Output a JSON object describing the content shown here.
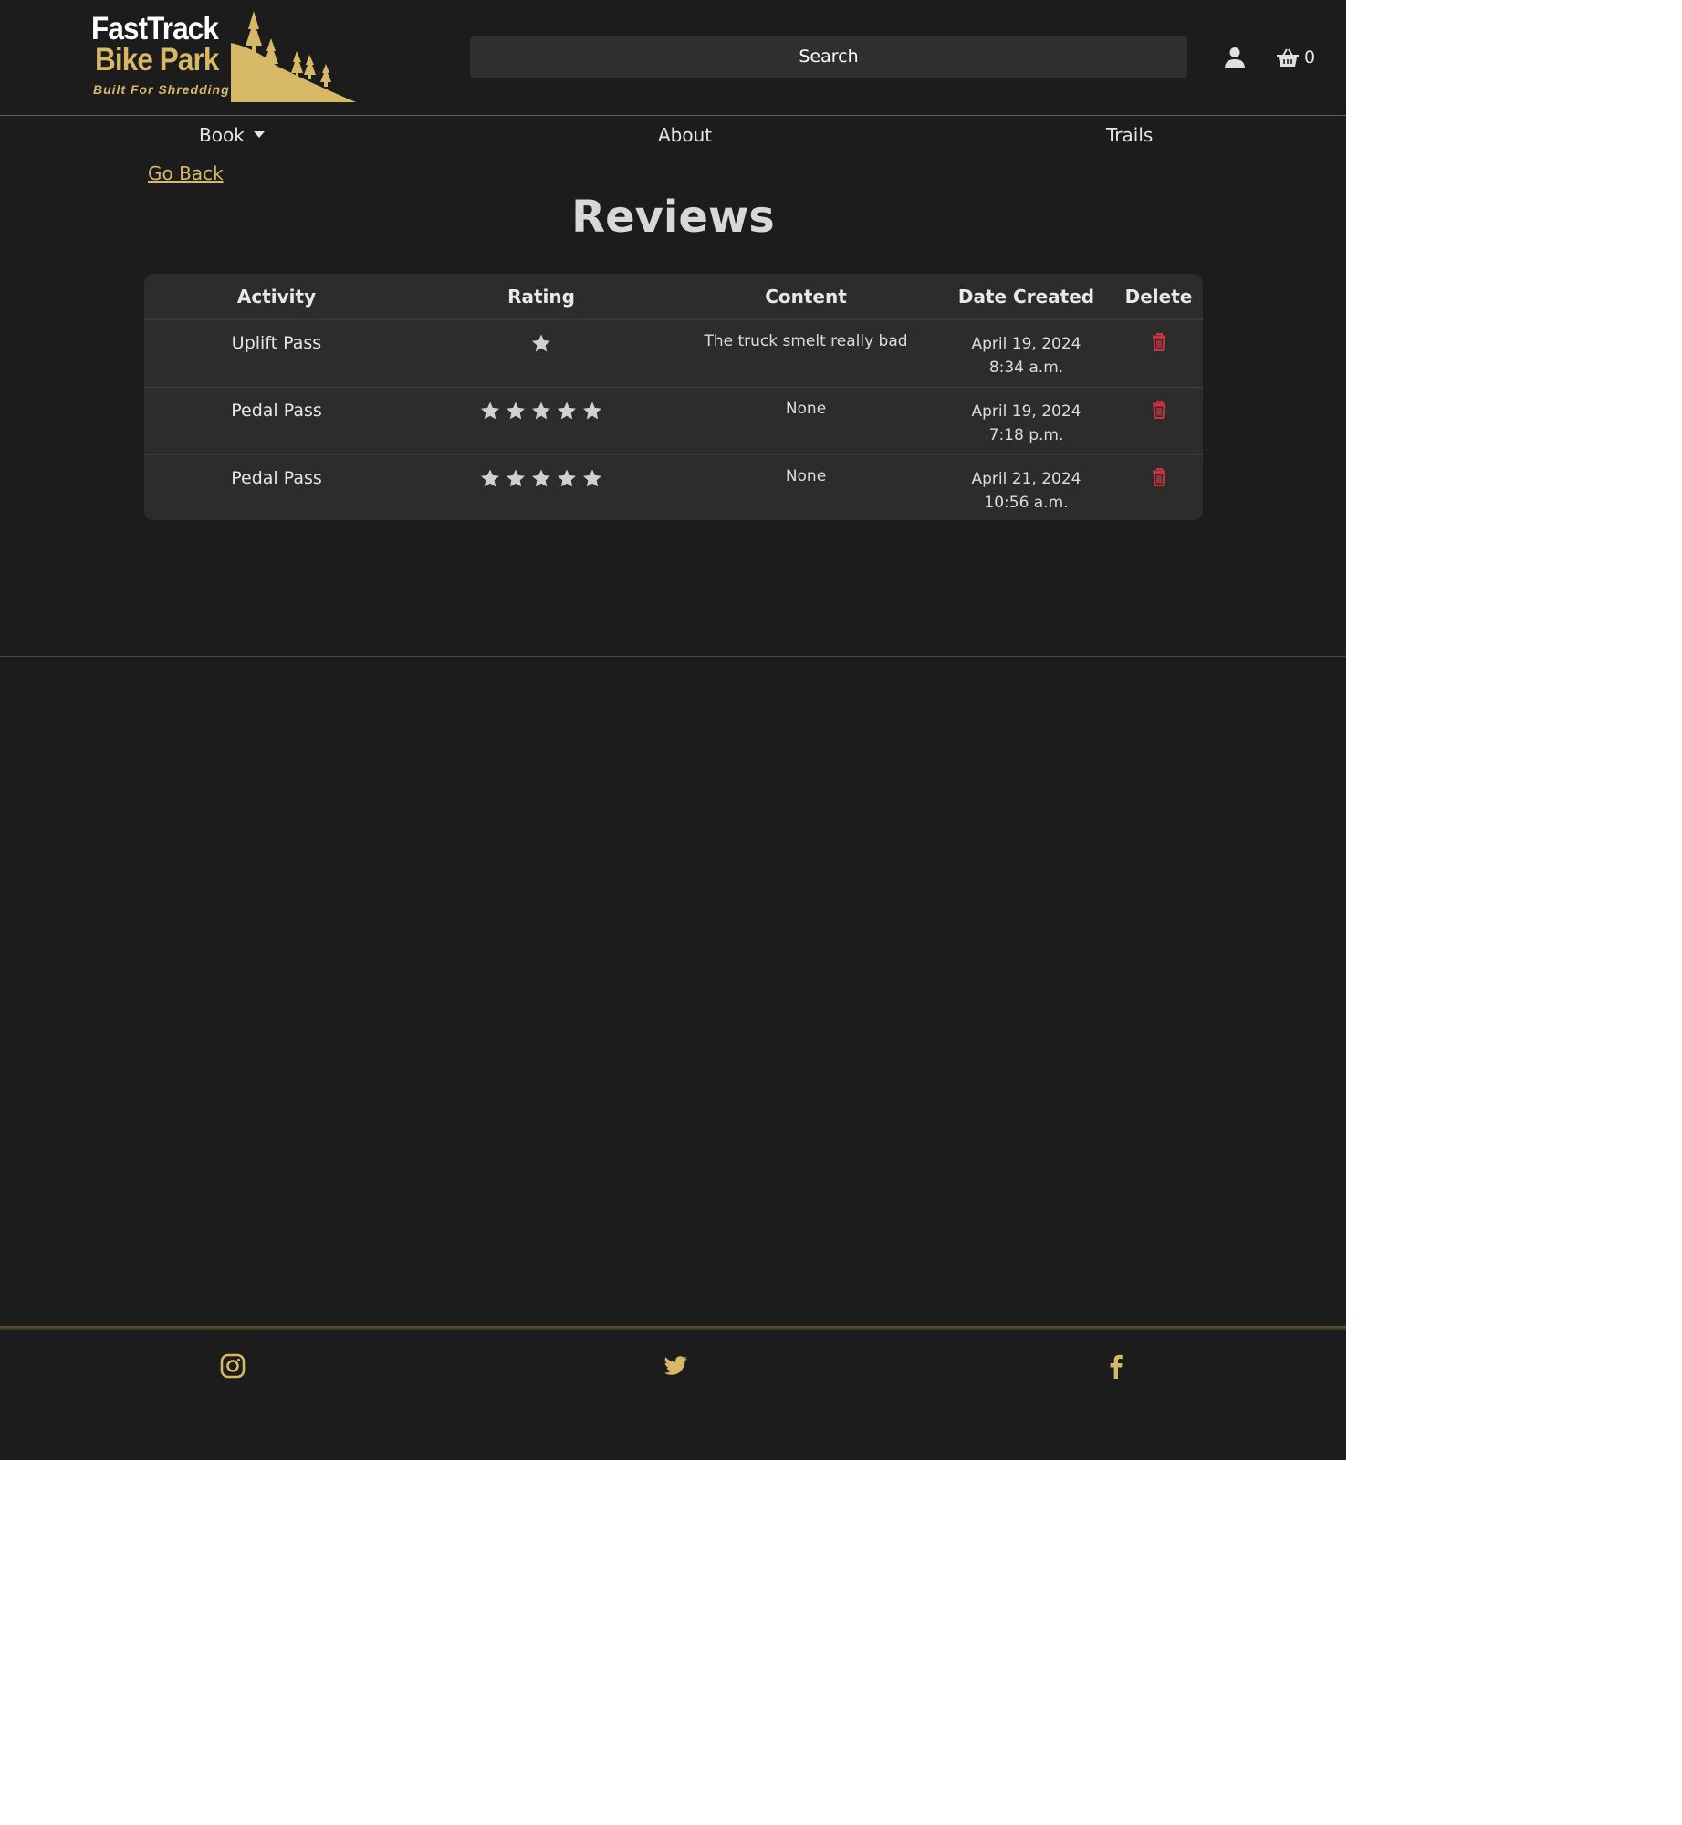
{
  "brand": {
    "line1": "FastTrack",
    "line2": "Bike Park",
    "tagline": "Built For Shredding"
  },
  "header": {
    "search_label": "Search",
    "cart_count": "0"
  },
  "nav": {
    "book": "Book",
    "about": "About",
    "trails": "Trails"
  },
  "go_back": "Go Back",
  "page_title": "Reviews",
  "table": {
    "headers": [
      "Activity",
      "Rating",
      "Content",
      "Date Created",
      "Delete"
    ],
    "rows": [
      {
        "activity": "Uplift Pass",
        "rating": 1,
        "content": "The truck smelt really bad",
        "date": "April 19, 2024",
        "time": "8:34 a.m."
      },
      {
        "activity": "Pedal Pass",
        "rating": 5,
        "content": "None",
        "date": "April 19, 2024",
        "time": "7:18 p.m."
      },
      {
        "activity": "Pedal Pass",
        "rating": 5,
        "content": "None",
        "date": "April 21, 2024",
        "time": "10:56 a.m."
      }
    ]
  },
  "icons": {
    "user": "user-icon",
    "cart": "basket-icon",
    "star": "star-icon",
    "delete": "trash-icon",
    "social": [
      "instagram-icon",
      "twitter-icon",
      "facebook-icon"
    ]
  },
  "colors": {
    "background": "#1c1c1c",
    "accent": "#d7b866",
    "table_bg": "#2c2c2c",
    "delete": "#c9343f",
    "star": "#d0d0d0"
  }
}
